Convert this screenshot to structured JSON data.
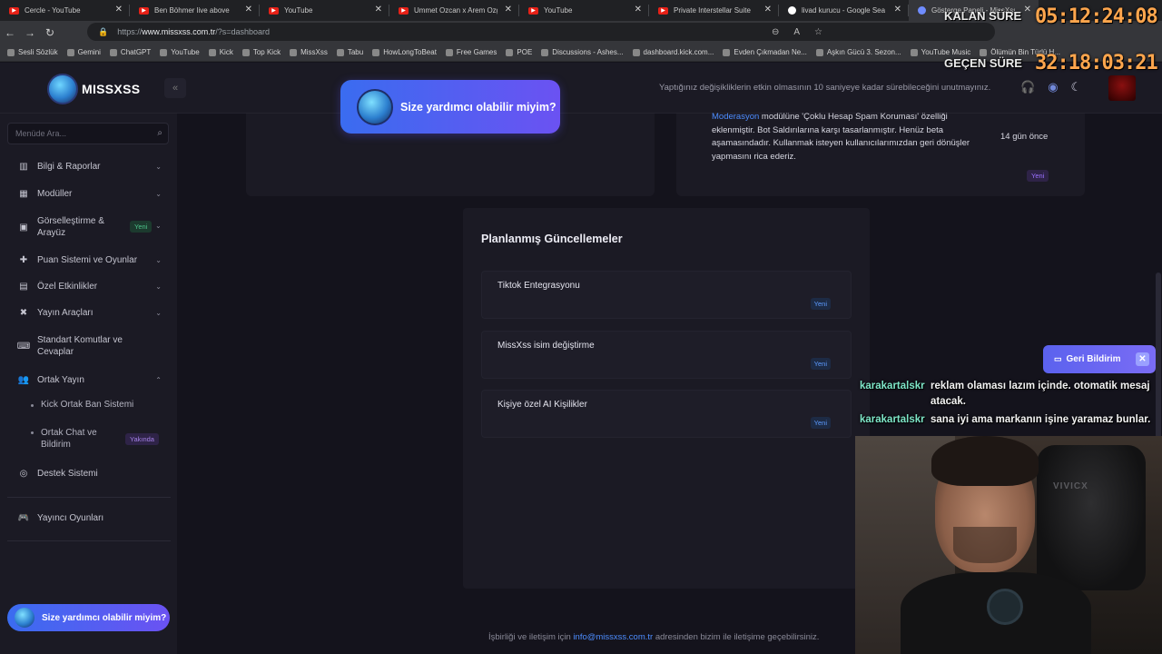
{
  "browser": {
    "tabs": [
      {
        "title": "Cercle - YouTube",
        "icon": "youtube-icon"
      },
      {
        "title": "Ben Böhmer live above",
        "icon": "youtube-icon"
      },
      {
        "title": "YouTube",
        "icon": "youtube-icon"
      },
      {
        "title": "Ummet Ozcan x Arem Ozgu",
        "icon": "youtube-icon"
      },
      {
        "title": "YouTube",
        "icon": "youtube-icon"
      },
      {
        "title": "Private Interstellar Suite",
        "icon": "youtube-icon"
      },
      {
        "title": "livad kurucu - Google Search",
        "icon": "google-icon"
      },
      {
        "title": "Gösterge Paneli - MissXss",
        "icon": "missxss-icon"
      }
    ],
    "url_prefix": "https://",
    "url_host": "www.missxss.com.tr",
    "url_path": "/?s=dashboard",
    "bookmarks": [
      "Sesli Sözlük",
      "Gemini",
      "ChatGPT",
      "YouTube",
      "Kick",
      "Top Kick",
      "MissXss",
      "Tabu",
      "HowLongToBeat",
      "Free Games",
      "POE",
      "Discussions - Ashes...",
      "dashboard.kick.com...",
      "Evden Çıkmadan Ne...",
      "Aşkın Gücü 3. Sezon...",
      "YouTube Music",
      "Ölümün Bin Türlü H..."
    ]
  },
  "overlay": {
    "remaining_label": "KALAN SÜRE",
    "remaining_time": "05:12:24:08",
    "elapsed_label": "GEÇEN SÜRE",
    "elapsed_time": "32:18:03:21"
  },
  "header": {
    "logo_text": "MISSXSS",
    "notice": "Yaptığınız değişikliklerin etkin olmasının 10 saniyeye kadar sürebileceğini unutmayınız.",
    "help_text": "Size yardımcı olabilir miyim?"
  },
  "sidebar": {
    "search_placeholder": "Menüde Ara...",
    "items": [
      {
        "label": "Bilgi & Raporlar",
        "icon": "chart-icon"
      },
      {
        "label": "Modüller",
        "icon": "grid-icon"
      },
      {
        "label": "Görselleştirme & Arayüz",
        "icon": "palette-icon",
        "badge": "Yeni"
      },
      {
        "label": "Puan Sistemi ve Oyunlar",
        "icon": "gift-icon"
      },
      {
        "label": "Özel Etkinlikler",
        "icon": "calendar-icon"
      },
      {
        "label": "Yayın Araçları",
        "icon": "tools-icon"
      },
      {
        "label": "Standart Komutlar ve Cevaplar",
        "icon": "keyboard-icon"
      },
      {
        "label": "Ortak Yayın",
        "icon": "users-icon"
      }
    ],
    "sub_items": [
      {
        "label": "Kick Ortak Ban Sistemi"
      },
      {
        "label": "Ortak Chat ve Bildirim",
        "badge": "Yakında"
      }
    ],
    "support": "Destek Sistemi",
    "streamer_games": "Yayıncı Oyunları",
    "help_text": "Size yardımcı olabilir miyim?"
  },
  "updates": {
    "highlight": "Moderasyon",
    "text": " modülüne 'Çoklu Hesap Spam Koruması' özelliği eklenmiştir. Bot Saldırılarına karşı tasarlanmıştır. Henüz beta aşamasındadır. Kullanmak isteyen kullanıcılarımızdan geri dönüşler yapmasını rica ederiz.",
    "ago": "14 gün önce",
    "badge": "Yeni"
  },
  "planned": {
    "title": "Planlanmış Güncellemeler",
    "items": [
      {
        "name": "Tiktok Entegrasyonu",
        "badge": "Yeni"
      },
      {
        "name": "MissXss isim değiştirme",
        "badge": "Yeni"
      },
      {
        "name": "Kişiye özel AI Kişilikler",
        "badge": "Yeni"
      }
    ]
  },
  "footer": {
    "before": "İşbirliği ve iletişim için ",
    "email": "info@missxss.com.tr",
    "after": " adresinden bizim ile iletişime geçebilirsiniz."
  },
  "feedback": {
    "label": "Geri Bildirim"
  },
  "chat": [
    {
      "user": "karakartalskr",
      "message": "reklam olaması lazım içinde. otomatik mesaj atacak."
    },
    {
      "user": "karakartalskr",
      "message": "sana iyi ama markanın işine yaramaz bunlar."
    }
  ],
  "webcam": {
    "chair_brand": "VIVICX"
  },
  "colors": {
    "accent": "#5b62ee",
    "link": "#4d8dff",
    "timer": "#ffa64d",
    "chat_user": "#7ee6c8"
  }
}
